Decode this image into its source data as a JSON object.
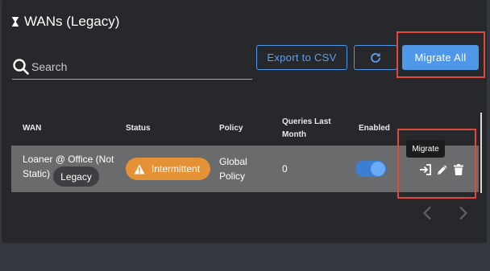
{
  "header": {
    "title": "WANs (Legacy)",
    "icon": "hourglass-icon"
  },
  "search": {
    "placeholder": "Search",
    "value": ""
  },
  "toolbar": {
    "export_label": "Export to CSV",
    "refresh_icon": "refresh-icon",
    "migrate_all_label": "Migrate All"
  },
  "table": {
    "columns": [
      "WAN",
      "Status",
      "Policy",
      "Queries Last Month",
      "Enabled"
    ],
    "rows": [
      {
        "wan": "Loaner @ Office (Not Static)",
        "badge": "Legacy",
        "status": "Intermittent",
        "policy": "Global Policy",
        "queries": "0",
        "enabled": true,
        "tooltip": "Migrate"
      }
    ]
  },
  "colors": {
    "accent": "#4f97e8",
    "warning": "#e59135",
    "highlight": "#e0483c",
    "panel": "#26282c",
    "row": "#6a6b6d"
  }
}
